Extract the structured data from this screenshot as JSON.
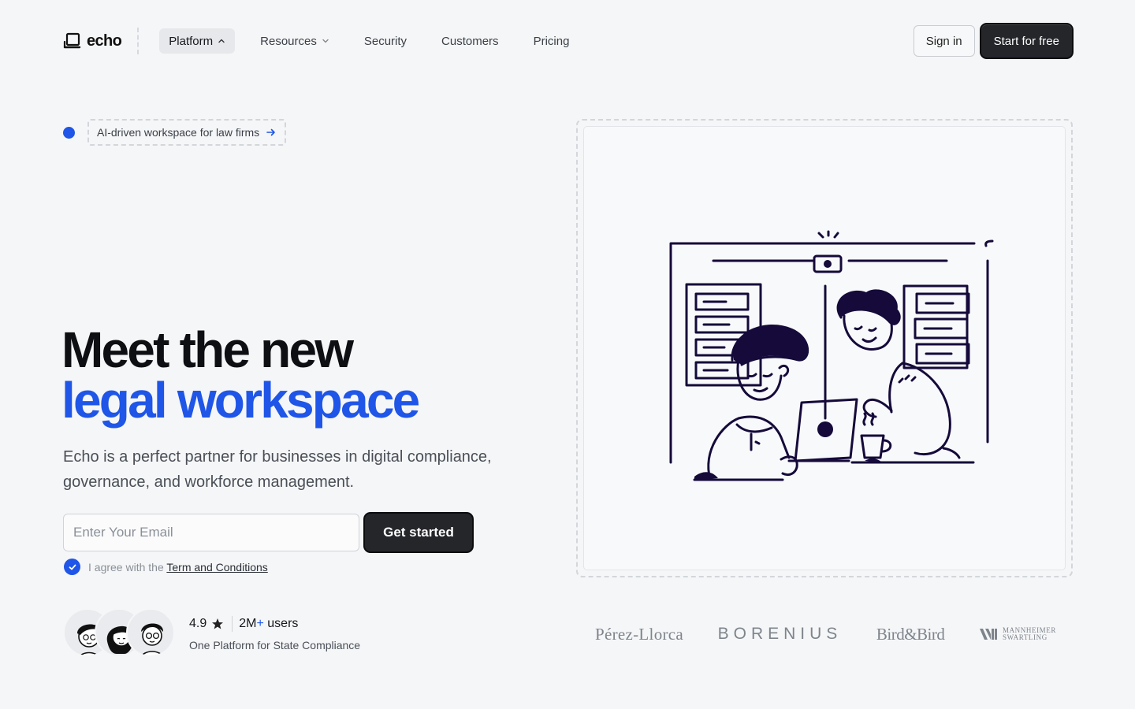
{
  "nav": {
    "logo_text": "echo",
    "links": [
      {
        "label": "Platform",
        "icon": "chevron-up-icon",
        "active": true
      },
      {
        "label": "Resources",
        "icon": "chevron-down-icon",
        "active": false
      },
      {
        "label": "Security"
      },
      {
        "label": "Customers"
      },
      {
        "label": "Pricing"
      }
    ],
    "sign_in": "Sign in",
    "start_free": "Start for free"
  },
  "badge": {
    "text": "AI-driven workspace for law firms",
    "icon": "arrow-right-icon",
    "accent": "#1f56e8"
  },
  "hero": {
    "title_line1": "Meet the new",
    "title_line2": "legal workspace",
    "description": "Echo is a perfect partner for businesses in digital compliance, governance, and workforce management."
  },
  "signup": {
    "email_placeholder": "Enter Your Email",
    "email_value": "",
    "cta": "Get started",
    "agree_prefix": "I agree with the",
    "agree_link": "Term and Conditions",
    "agree_checked": true
  },
  "social_proof": {
    "rating": "4.9",
    "users_count": "2M",
    "users_plus": "+",
    "users_label": "users",
    "subline": "One Platform for State Compliance"
  },
  "client_logos": {
    "perez": "Pérez-Llorca",
    "borenius": "BORENIUS",
    "bird": "Bird&Bird",
    "mannheimer_line1": "MANNHEIMER",
    "mannheimer_line2": "SWARTLING"
  },
  "colors": {
    "accent": "#1f56e8",
    "dark_button": "#24262a",
    "background": "#f5f6f7"
  }
}
